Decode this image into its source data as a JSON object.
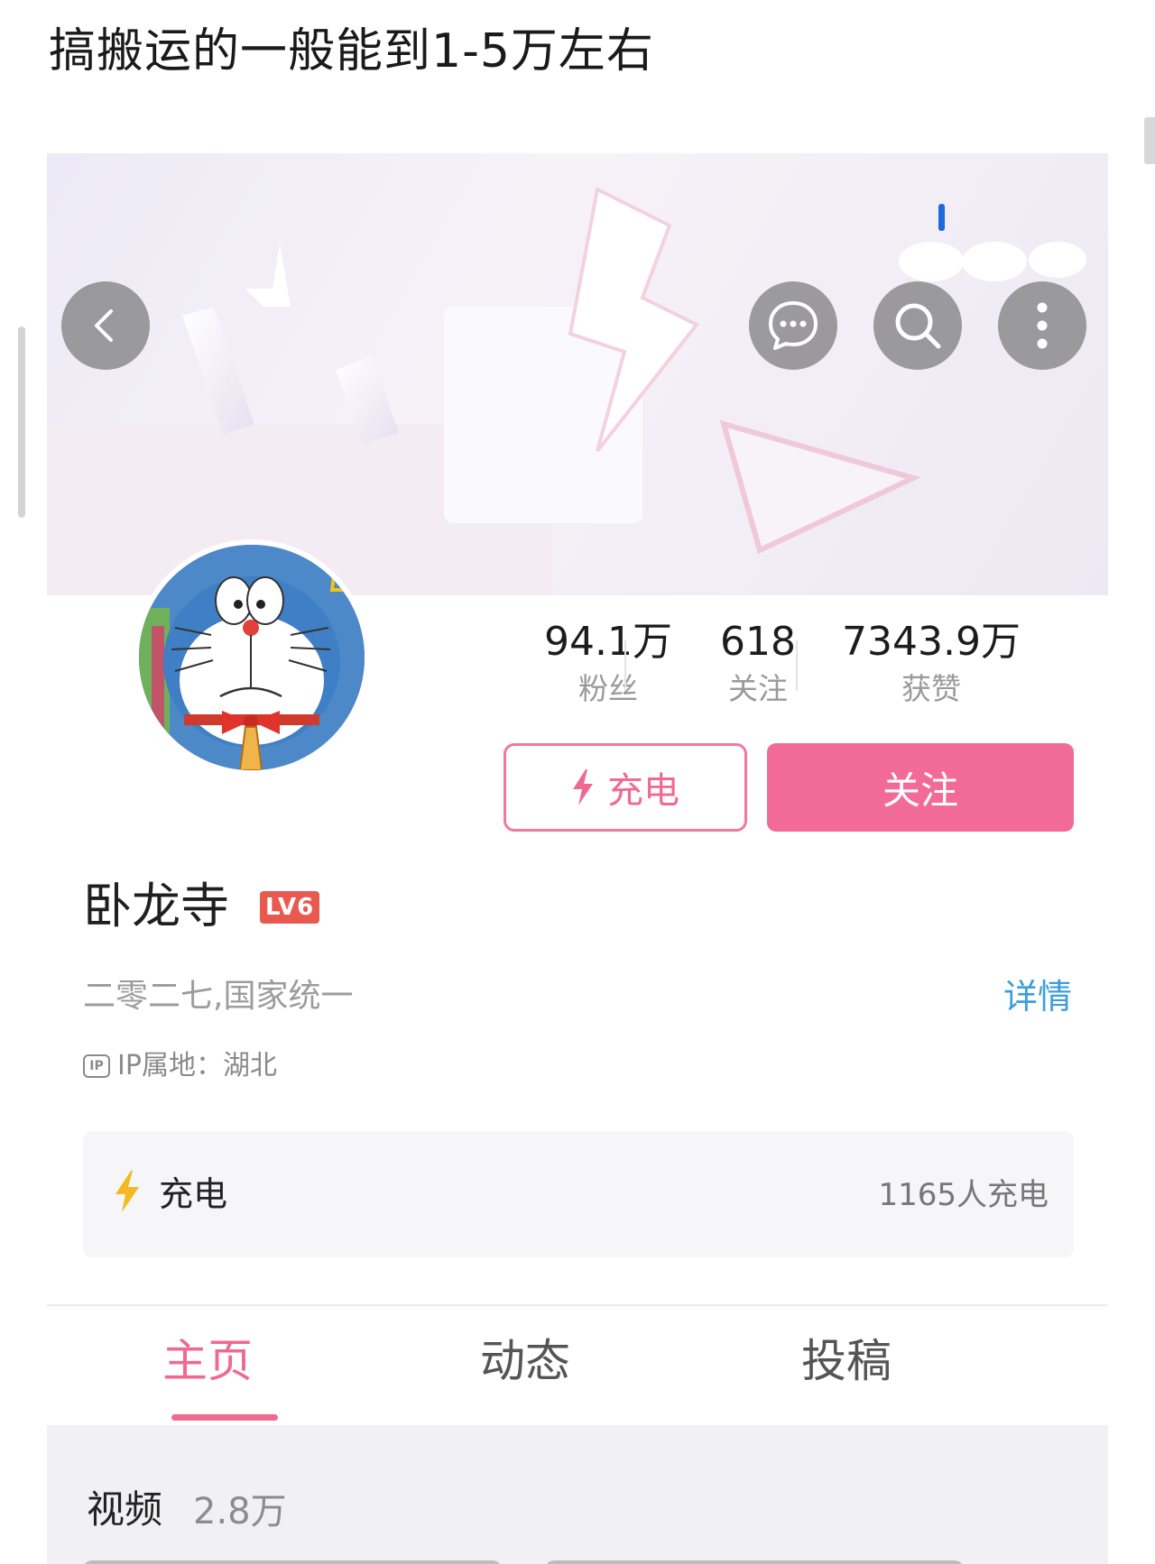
{
  "caption": "搞搬运的一般能到1-5万左右",
  "profile": {
    "username": "卧龙寺",
    "level_badge": "LV6",
    "bio": "二零二七,国家统一",
    "detail_link": "详情",
    "ip_location": "IP属地：湖北",
    "ip_icon_text": "IP"
  },
  "stats": [
    {
      "value": "94.1万",
      "label": "粉丝"
    },
    {
      "value": "618",
      "label": "关注"
    },
    {
      "value": "7343.9万",
      "label": "获赞"
    }
  ],
  "buttons": {
    "charge": "充电",
    "follow": "关注"
  },
  "charge_panel": {
    "label": "充电",
    "count": "1165人充电"
  },
  "tabs": [
    {
      "label": "主页",
      "active": true
    },
    {
      "label": "动态",
      "active": false
    },
    {
      "label": "投稿",
      "active": false
    }
  ],
  "videos_section": {
    "title": "视频",
    "count": "2.8万"
  },
  "icons": {
    "back": "back-arrow-icon",
    "message": "message-icon",
    "search": "search-icon",
    "more": "more-icon",
    "lightning": "lightning-icon"
  },
  "colors": {
    "accent_pink": "#f26b98",
    "link_blue": "#3c9fd8",
    "level_red": "#e85a4f",
    "charge_yellow": "#f5b820"
  }
}
